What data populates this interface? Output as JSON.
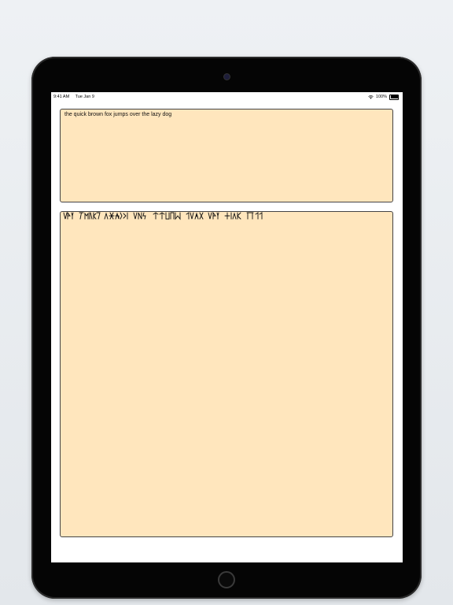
{
  "status_bar": {
    "time": "9:41 AM",
    "date": "Tue Jan 9",
    "battery": "100%"
  },
  "input": {
    "text": "the quick brown fox jumps over the lazy dog"
  },
  "output": {
    "description_script": "runic-transliteration"
  }
}
